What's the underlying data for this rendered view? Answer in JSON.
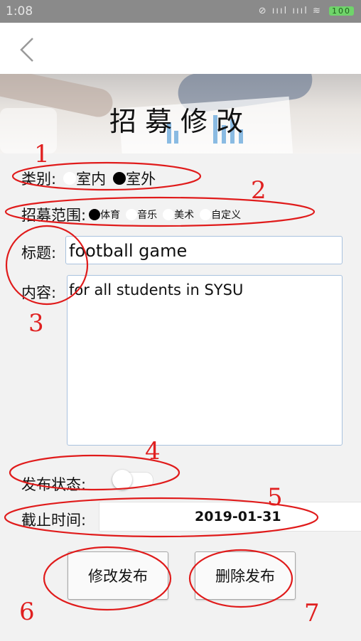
{
  "status_bar": {
    "time": "1:08",
    "signal": "⊘ ıııl ıııl ≋",
    "battery": "100"
  },
  "banner": {
    "title": "招募修改"
  },
  "category": {
    "label": "类别:",
    "options": [
      {
        "label": "室内",
        "selected": false
      },
      {
        "label": "室外",
        "selected": true
      }
    ]
  },
  "scope": {
    "label": "招募范围:",
    "options": [
      {
        "label": "体育",
        "selected": true
      },
      {
        "label": "音乐",
        "selected": false
      },
      {
        "label": "美术",
        "selected": false
      },
      {
        "label": "自定义",
        "selected": false
      }
    ]
  },
  "title_field": {
    "label": "标题:",
    "value": "football game"
  },
  "content_field": {
    "label": "内容:",
    "value": "for all students in SYSU"
  },
  "publish_status": {
    "label": "发布状态:",
    "on": false
  },
  "deadline": {
    "label": "截止时间:",
    "value": "2019-01-31"
  },
  "buttons": {
    "modify": "修改发布",
    "delete": "删除发布"
  },
  "annotations": {
    "n1": "1",
    "n2": "2",
    "n3": "3",
    "n4": "4",
    "n5": "5",
    "n6": "6",
    "n7": "7"
  },
  "colors": {
    "annotation_red": "#e01b1b",
    "input_border": "#a9c2de",
    "status_bar": "#8a8a8a"
  }
}
